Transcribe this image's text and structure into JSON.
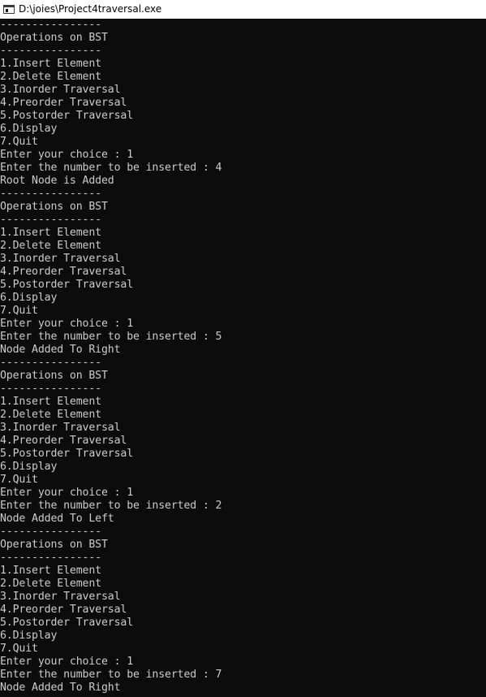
{
  "window": {
    "title": "D:\\joies\\Project4traversal.exe",
    "icon": "console-window-icon"
  },
  "colors": {
    "console_background": "#0c0c0c",
    "console_text": "#cccccc",
    "titlebar_background": "#ffffff"
  },
  "console": {
    "lines": [
      "----------------",
      "Operations on BST",
      "----------------",
      "1.Insert Element",
      "2.Delete Element",
      "3.Inorder Traversal",
      "4.Preorder Traversal",
      "5.Postorder Traversal",
      "6.Display",
      "7.Quit",
      "Enter your choice : 1",
      "Enter the number to be inserted : 4",
      "Root Node is Added",
      "----------------",
      "Operations on BST",
      "----------------",
      "1.Insert Element",
      "2.Delete Element",
      "3.Inorder Traversal",
      "4.Preorder Traversal",
      "5.Postorder Traversal",
      "6.Display",
      "7.Quit",
      "Enter your choice : 1",
      "Enter the number to be inserted : 5",
      "Node Added To Right",
      "----------------",
      "Operations on BST",
      "----------------",
      "1.Insert Element",
      "2.Delete Element",
      "3.Inorder Traversal",
      "4.Preorder Traversal",
      "5.Postorder Traversal",
      "6.Display",
      "7.Quit",
      "Enter your choice : 1",
      "Enter the number to be inserted : 2",
      "Node Added To Left",
      "----------------",
      "Operations on BST",
      "----------------",
      "1.Insert Element",
      "2.Delete Element",
      "3.Inorder Traversal",
      "4.Preorder Traversal",
      "5.Postorder Traversal",
      "6.Display",
      "7.Quit",
      "Enter your choice : 1",
      "Enter the number to be inserted : 7",
      "Node Added To Right"
    ]
  }
}
